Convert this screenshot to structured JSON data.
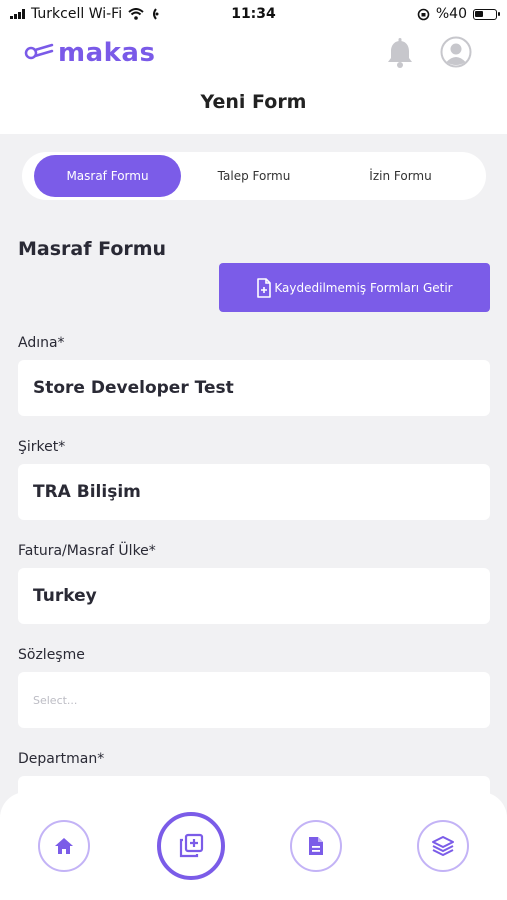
{
  "status_bar": {
    "carrier": "Turkcell Wi-Fi",
    "time": "11:34",
    "battery": "%40"
  },
  "header": {
    "logo_text": "makas",
    "page_title": "Yeni Form"
  },
  "tabs": [
    {
      "label": "Masraf Formu",
      "active": true
    },
    {
      "label": "Talep Formu",
      "active": false
    },
    {
      "label": "İzin Formu",
      "active": false
    }
  ],
  "form": {
    "title": "Masraf Formu",
    "unsaved_button": "Kaydedilmemiş Formları Getir",
    "fields": [
      {
        "label": "Adına*",
        "value": "Store Developer Test",
        "placeholder": ""
      },
      {
        "label": "Şirket*",
        "value": "TRA Bilişim",
        "placeholder": ""
      },
      {
        "label": "Fatura/Masraf Ülke*",
        "value": "Turkey",
        "placeholder": ""
      },
      {
        "label": "Sözleşme",
        "value": "",
        "placeholder": "Select..."
      },
      {
        "label": "Departman*",
        "value": "",
        "placeholder": ""
      }
    ]
  },
  "bottom_nav": [
    {
      "icon": "home-icon"
    },
    {
      "icon": "new-form-icon"
    },
    {
      "icon": "document-icon"
    },
    {
      "icon": "layers-icon"
    }
  ],
  "colors": {
    "accent": "#7b5ce8",
    "accent_light": "#c3b3f6",
    "background": "#f1f1f3"
  }
}
